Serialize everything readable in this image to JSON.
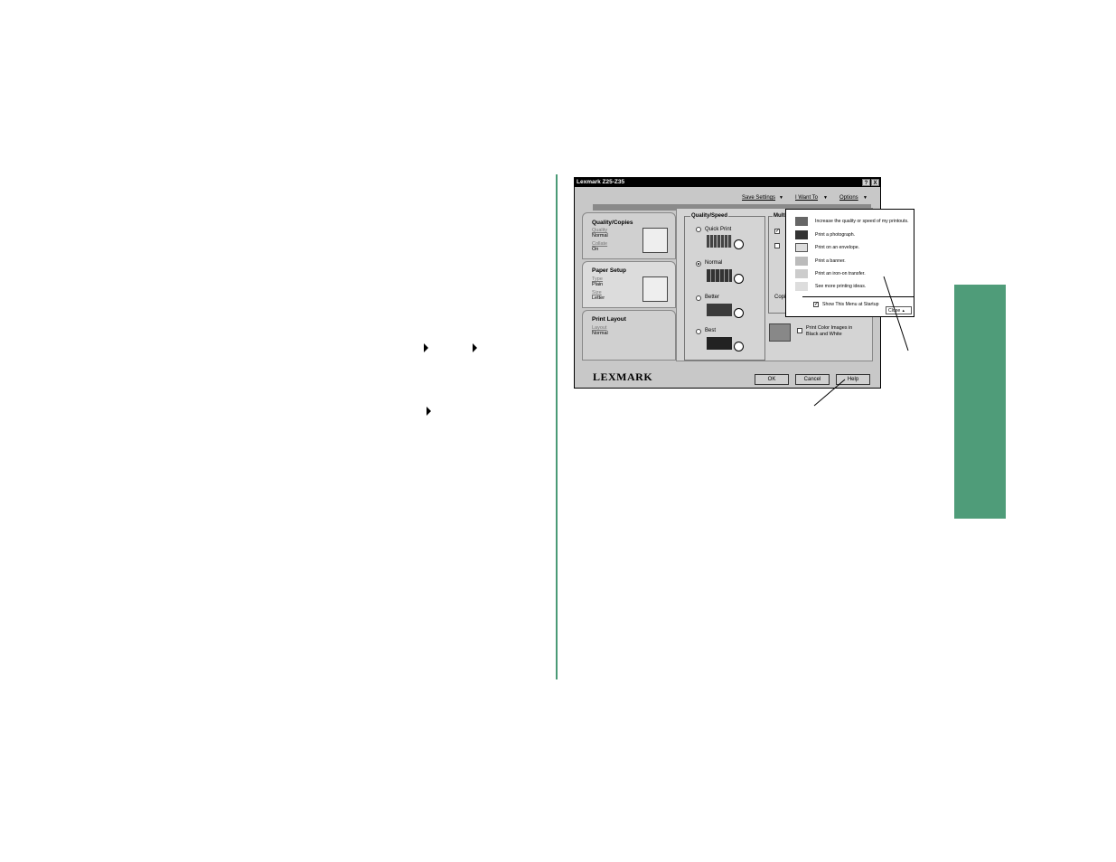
{
  "page": {
    "accent_color": "#4f9c79",
    "arrow_icon": "right-triangle-icon"
  },
  "dialog": {
    "title": "Lexmark Z25-Z35",
    "title_buttons": [
      "?",
      "X"
    ],
    "menu": [
      {
        "label": "Save Settings",
        "icon": "dropdown-arrow-icon"
      },
      {
        "label": "I Want To",
        "icon": "dropdown-arrow-icon"
      },
      {
        "label": "Options",
        "icon": "dropdown-arrow-icon"
      }
    ],
    "tabs": [
      {
        "header": "Quality/Copies",
        "lines": [
          {
            "label": "Quality",
            "value": "Normal"
          },
          {
            "label": "Collate",
            "value": "On"
          }
        ]
      },
      {
        "header": "Paper Setup",
        "lines": [
          {
            "label": "Type",
            "value": "Plain"
          },
          {
            "label": "Size",
            "value": "Letter"
          }
        ]
      },
      {
        "header": "Print Layout",
        "lines": [
          {
            "label": "Layout",
            "value": "Normal"
          }
        ]
      }
    ],
    "quality": {
      "legend": "Quality/Speed",
      "options": [
        "Quick Print",
        "Normal",
        "Better",
        "Best"
      ],
      "selected": "Normal"
    },
    "multiple_legend": "Multip",
    "copies_label": "Copie",
    "bw_label_line1": "Print Color Images in",
    "bw_label_line2": "Black and White",
    "buttons": {
      "ok": "OK",
      "cancel": "Cancel",
      "help": "Help"
    },
    "logo": "LEXMARK"
  },
  "popup": {
    "items": [
      "Increase the quality or speed of my printouts.",
      "Print a photograph.",
      "Print on an envelope.",
      "Print a banner.",
      "Print an iron-on transfer.",
      "See more printing ideas."
    ],
    "startup_label": "Show This Menu at Startup",
    "startup_checked": true,
    "close_label": "Close"
  }
}
